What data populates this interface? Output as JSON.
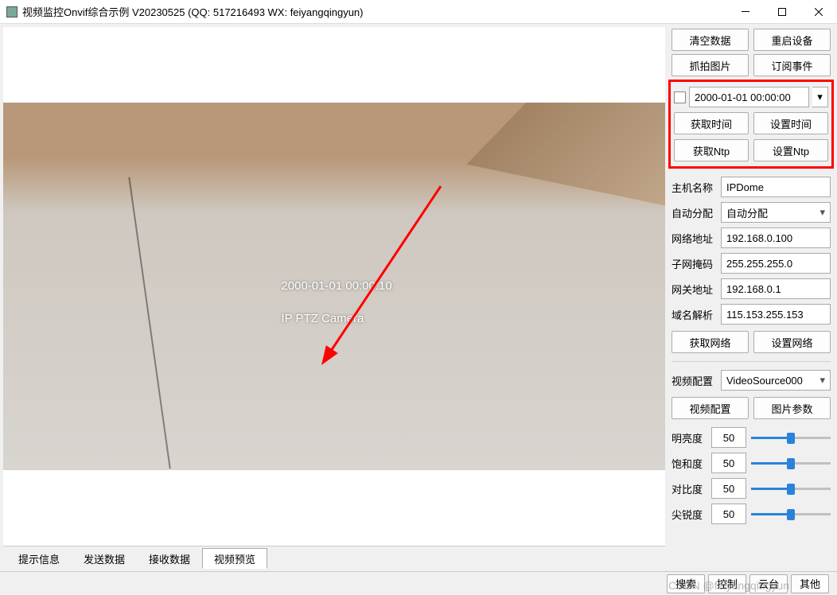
{
  "window": {
    "title": "视频监控Onvif综合示例 V20230525 (QQ: 517216493 WX: feiyangqingyun)"
  },
  "top_buttons": {
    "clear_data": "清空数据",
    "restart_device": "重启设备",
    "snapshot": "抓拍图片",
    "subscribe_event": "订阅事件"
  },
  "datetime": {
    "value": "2000-01-01 00:00:00",
    "get_time": "获取时间",
    "set_time": "设置时间",
    "get_ntp": "获取Ntp",
    "set_ntp": "设置Ntp"
  },
  "host": {
    "name_label": "主机名称",
    "name_value": "IPDome",
    "auto_label": "自动分配",
    "auto_value": "自动分配",
    "ip_label": "网络地址",
    "ip_value": "192.168.0.100",
    "mask_label": "子网掩码",
    "mask_value": "255.255.255.0",
    "gateway_label": "网关地址",
    "gateway_value": "192.168.0.1",
    "dns_label": "域名解析",
    "dns_value": "115.153.255.153",
    "get_network": "获取网络",
    "set_network": "设置网络"
  },
  "video": {
    "config_label": "视频配置",
    "source_value": "VideoSource000",
    "video_config_btn": "视频配置",
    "image_params_btn": "图片参数"
  },
  "sliders": {
    "brightness_label": "明亮度",
    "brightness_value": "50",
    "saturation_label": "饱和度",
    "saturation_value": "50",
    "contrast_label": "对比度",
    "contrast_value": "50",
    "sharpness_label": "尖锐度",
    "sharpness_value": "50"
  },
  "osd": {
    "timestamp": "2000-01-01 00:00:10",
    "camera_name": "IP PTZ Camera"
  },
  "tabs": {
    "info": "提示信息",
    "send": "发送数据",
    "recv": "接收数据",
    "preview": "视频预览"
  },
  "bottom": {
    "search": "搜索",
    "control": "控制",
    "ptz": "云台",
    "other": "其他"
  },
  "watermark": "CSDN @feiyangqingyun"
}
